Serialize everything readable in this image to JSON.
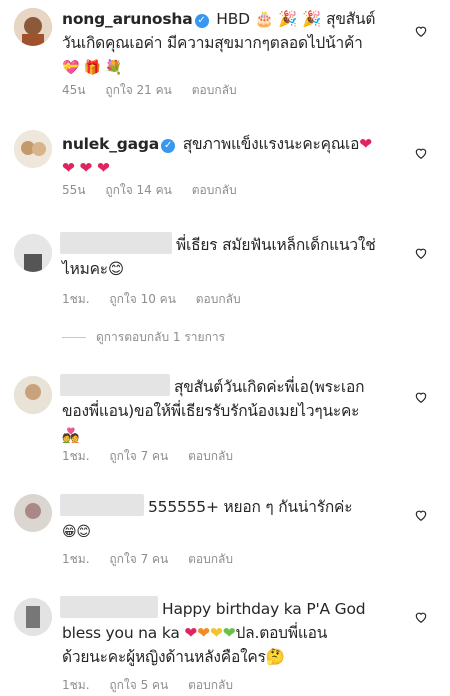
{
  "comments": [
    {
      "username": "nong_arunosha",
      "verified": true,
      "text_line1": "HBD 🎂 🎉 🎉 สุขสันต์",
      "text_line2": "วันเกิดคุณเอค่า มีความสุขมากๆตลอดไปน้าค้า",
      "text_line3": "💝 🎁 💐",
      "time": "45น",
      "likes": "ถูกใจ 21 คน",
      "reply": "ตอบกลับ"
    },
    {
      "username": "nulek_gaga",
      "verified": true,
      "text_line1": "สุขภาพแข็งแรงนะคะคุณเอ",
      "text_line2": "",
      "time": "55น",
      "likes": "ถูกใจ 14 คน",
      "reply": "ตอบกลับ"
    },
    {
      "username": "",
      "text_line1": "พี่เธียร สมัยฟันเหล็กเด็กแนวใช่",
      "text_line2": "ไหมคะ😊",
      "time": "1ชม.",
      "likes": "ถูกใจ 10 คน",
      "reply": "ตอบกลับ"
    },
    {
      "username": "",
      "text_line1": "สุขสันต์วันเกิดค่ะพี่เอ(พระเอก",
      "text_line2": "ของพี่แอน)ขอให้พี่เธียรรับรักน้องเมยไวๆนะคะ",
      "text_line3": "💑",
      "time": "1ชม.",
      "likes": "ถูกใจ 7 คน",
      "reply": "ตอบกลับ"
    },
    {
      "username": "",
      "text_line1": "555555+ หยอก ๆ กันน่ารักค่ะ",
      "text_line2": "😁😊",
      "time": "1ชม.",
      "likes": "ถูกใจ 7 คน",
      "reply": "ตอบกลับ"
    },
    {
      "username": "",
      "text_line1": "Happy birthday ka P'A God",
      "text_line2": "bless you na ka",
      "text_line2b": "ปล.ตอบพี่แอน",
      "text_line3": "ด้วยนะคะผู้หญิงด้านหลังคือใคร🤔",
      "time": "1ชม.",
      "likes": "ถูกใจ 5 คน",
      "reply": "ตอบกลับ"
    }
  ],
  "view_replies": "ดูการตอบกลับ 1 รายการ",
  "icons": {
    "like": "heart-outline-icon",
    "verified": "verified-badge-icon"
  },
  "colors": {
    "text": "#262626",
    "meta": "#8e8e8e",
    "verified": "#3897f0"
  }
}
